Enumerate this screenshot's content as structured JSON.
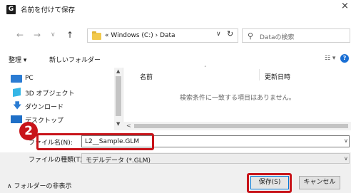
{
  "window": {
    "app_icon_letter": "G",
    "title": "名前を付けて保存",
    "close_symbol": "×"
  },
  "nav": {
    "back_symbol": "←",
    "forward_symbol": "→",
    "recent_symbol": "∨",
    "up_symbol": "↑",
    "address_path": "« Windows (C:) › Data",
    "address_dropdown_symbol": "∨",
    "refresh_symbol": "↻",
    "search_placeholder": "Dataの検索",
    "search_icon": "search-icon"
  },
  "toolbar": {
    "organize_label": "整理 ▾",
    "new_folder_label": "新しいフォルダー",
    "view_label": "☷ ▾",
    "help_symbol": "?"
  },
  "sidebar": {
    "items": [
      {
        "label": "PC",
        "icon": "computer-icon"
      },
      {
        "label": "3D オブジェクト",
        "icon": "3d-objects-icon"
      },
      {
        "label": "ダウンロード",
        "icon": "download-icon"
      },
      {
        "label": "デスクトップ",
        "icon": "desktop-icon"
      }
    ]
  },
  "file_list": {
    "column_name": "名前",
    "column_date": "更新日時",
    "empty_message": "検索条件に一致する項目はありません。"
  },
  "form": {
    "filename_label": "ファイル名(N):",
    "filename_value": "L2__Sample.GLM",
    "filetype_label": "ファイルの種類(T):",
    "filetype_value": "モデルデータ (*.GLM)"
  },
  "footer": {
    "hide_folders_label": "∧ フォルダーの非表示",
    "save_label": "保存(S)",
    "cancel_label": "キャンセル"
  },
  "annotation": {
    "step_number": "2"
  },
  "colors": {
    "accent": "#0078d7",
    "callout": "#c8141a",
    "folder": "#f2c94c"
  }
}
